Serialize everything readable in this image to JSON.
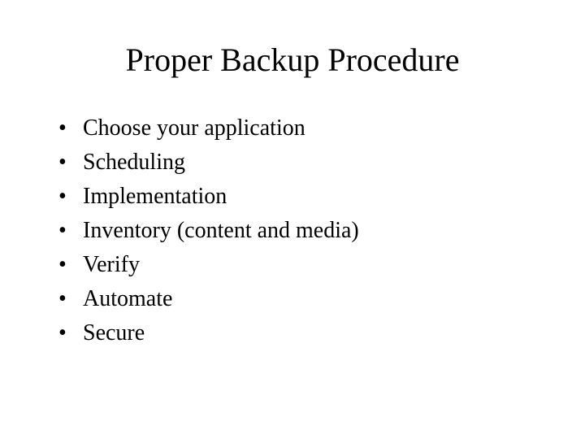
{
  "slide": {
    "title": "Proper Backup Procedure",
    "bullets": [
      "Choose your application",
      "Scheduling",
      "Implementation",
      "Inventory (content and media)",
      "Verify",
      "Automate",
      "Secure"
    ]
  }
}
